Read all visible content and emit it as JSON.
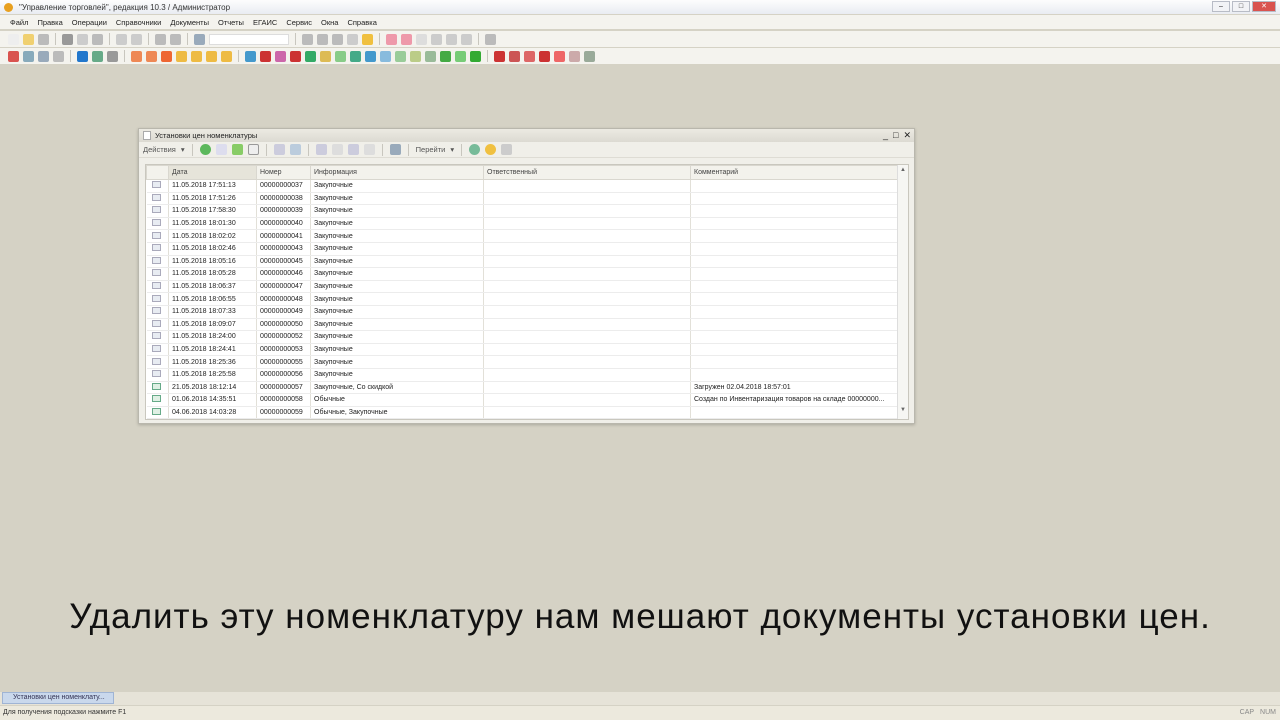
{
  "app": {
    "title": "\"Управление торговлей\", редакция 10.3 / Администратор"
  },
  "menu": [
    "Файл",
    "Правка",
    "Операции",
    "Справочники",
    "Документы",
    "Отчеты",
    "ЕГАИС",
    "Сервис",
    "Окна",
    "Справка"
  ],
  "window": {
    "title": "Установки цен номенклатуры",
    "toolbar": {
      "actions": "Действия",
      "goto": "Перейти"
    },
    "columns": [
      "Дата",
      "Номер",
      "Информация",
      "Ответственный",
      "Комментарий"
    ],
    "rows": [
      {
        "date": "11.05.2018 17:51:13",
        "number": "00000000037",
        "info": "Закупочные",
        "resp": "",
        "comment": "",
        "posted": false
      },
      {
        "date": "11.05.2018 17:51:26",
        "number": "00000000038",
        "info": "Закупочные",
        "resp": "",
        "comment": "",
        "posted": false
      },
      {
        "date": "11.05.2018 17:58:30",
        "number": "00000000039",
        "info": "Закупочные",
        "resp": "",
        "comment": "",
        "posted": false
      },
      {
        "date": "11.05.2018 18:01:30",
        "number": "00000000040",
        "info": "Закупочные",
        "resp": "",
        "comment": "",
        "posted": false
      },
      {
        "date": "11.05.2018 18:02:02",
        "number": "00000000041",
        "info": "Закупочные",
        "resp": "",
        "comment": "",
        "posted": false
      },
      {
        "date": "11.05.2018 18:02:46",
        "number": "00000000043",
        "info": "Закупочные",
        "resp": "",
        "comment": "",
        "posted": false
      },
      {
        "date": "11.05.2018 18:05:16",
        "number": "00000000045",
        "info": "Закупочные",
        "resp": "",
        "comment": "",
        "posted": false
      },
      {
        "date": "11.05.2018 18:05:28",
        "number": "00000000046",
        "info": "Закупочные",
        "resp": "",
        "comment": "",
        "posted": false
      },
      {
        "date": "11.05.2018 18:06:37",
        "number": "00000000047",
        "info": "Закупочные",
        "resp": "",
        "comment": "",
        "posted": false
      },
      {
        "date": "11.05.2018 18:06:55",
        "number": "00000000048",
        "info": "Закупочные",
        "resp": "",
        "comment": "",
        "posted": false
      },
      {
        "date": "11.05.2018 18:07:33",
        "number": "00000000049",
        "info": "Закупочные",
        "resp": "",
        "comment": "",
        "posted": false
      },
      {
        "date": "11.05.2018 18:09:07",
        "number": "00000000050",
        "info": "Закупочные",
        "resp": "",
        "comment": "",
        "posted": false
      },
      {
        "date": "11.05.2018 18:24:00",
        "number": "00000000052",
        "info": "Закупочные",
        "resp": "",
        "comment": "",
        "posted": false
      },
      {
        "date": "11.05.2018 18:24:41",
        "number": "00000000053",
        "info": "Закупочные",
        "resp": "",
        "comment": "",
        "posted": false
      },
      {
        "date": "11.05.2018 18:25:36",
        "number": "00000000055",
        "info": "Закупочные",
        "resp": "",
        "comment": "",
        "posted": false
      },
      {
        "date": "11.05.2018 18:25:58",
        "number": "00000000056",
        "info": "Закупочные",
        "resp": "",
        "comment": "",
        "posted": false
      },
      {
        "date": "21.05.2018 18:12:14",
        "number": "00000000057",
        "info": "Закупочные, Со скидкой",
        "resp": "",
        "comment": "Загружен 02.04.2018 18:57:01",
        "posted": true
      },
      {
        "date": "01.06.2018 14:35:51",
        "number": "00000000058",
        "info": "Обычные",
        "resp": "",
        "comment": "Создан по Инвентаризация товаров на складе 00000000...",
        "posted": true
      },
      {
        "date": "04.06.2018 14:03:28",
        "number": "00000000059",
        "info": "Обычные, Закупочные",
        "resp": "",
        "comment": "",
        "posted": true
      }
    ]
  },
  "subtitle": "Удалить эту номенклатуру нам мешают документы установки цен.",
  "taskbar": {
    "item": "Установки цен номенклату..."
  },
  "status": {
    "hint": "Для получения подсказки нажмите F1",
    "cap": "CAP",
    "num": "NUM"
  }
}
